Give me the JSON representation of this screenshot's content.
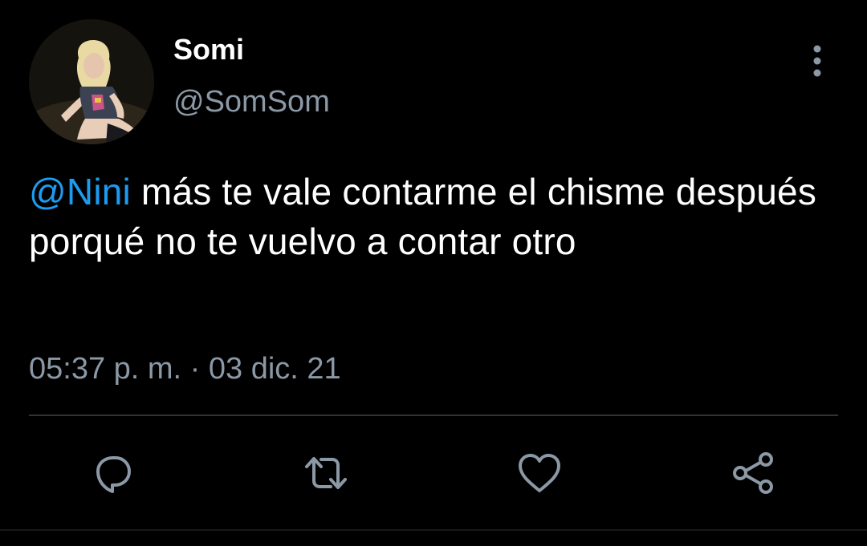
{
  "tweet": {
    "author": {
      "display_name": "Somi",
      "handle": "@SomSom",
      "avatar": "profile-photo"
    },
    "text": {
      "mention": "@Nini",
      "body": " más te vale contarme el chisme después porqué no te vuelvo a contar otro"
    },
    "timestamp": "05:37 p. m. · 03 dic. 21",
    "actions": [
      {
        "name": "reply",
        "icon": "speech-bubble-icon"
      },
      {
        "name": "retweet",
        "icon": "retweet-arrows-icon"
      },
      {
        "name": "like",
        "icon": "heart-icon"
      },
      {
        "name": "share",
        "icon": "share-nodes-icon"
      }
    ],
    "more_menu_icon": "vertical-dots-icon"
  },
  "colors": {
    "background": "#000000",
    "text_primary": "#ffffff",
    "text_secondary": "#8b98a5",
    "mention": "#1d9bf0",
    "divider": "#2f3336"
  }
}
